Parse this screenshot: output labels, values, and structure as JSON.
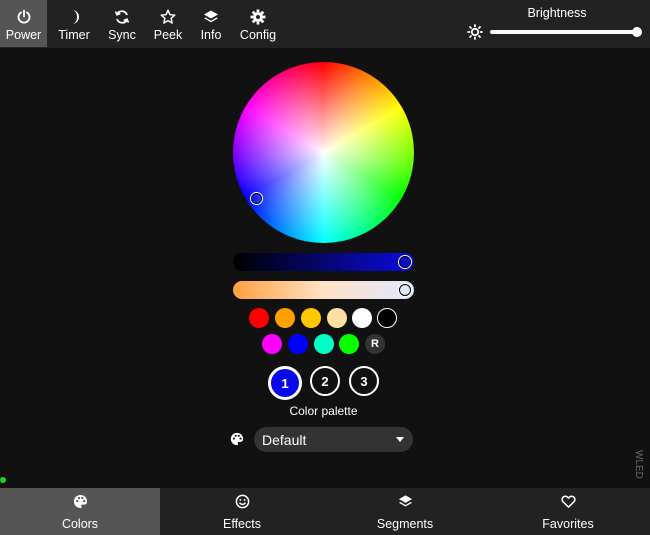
{
  "topbar": {
    "buttons": [
      {
        "label": "Power",
        "icon": "power-icon",
        "active": true
      },
      {
        "label": "Timer",
        "icon": "moon-icon"
      },
      {
        "label": "Sync",
        "icon": "sync-icon"
      },
      {
        "label": "Peek",
        "icon": "star-icon"
      },
      {
        "label": "Info",
        "icon": "layers-icon"
      },
      {
        "label": "Config",
        "icon": "gear-icon"
      }
    ],
    "brightness_label": "Brightness",
    "brightness_level": 1.0
  },
  "colors": {
    "quick_swatches_row1": [
      "#ff0000",
      "#ffa000",
      "#ffc800",
      "#ffe0a0",
      "#ffffff",
      "#000000"
    ],
    "quick_swatches_row2": [
      "#ff00ff",
      "#0000ff",
      "#00ffc8",
      "#08ff00"
    ],
    "random_label": "R",
    "slots": [
      "1",
      "2",
      "3"
    ],
    "selected_slot": "1",
    "selected_color": "#0a0ae8",
    "palette_label": "Color palette",
    "palette_value": "Default"
  },
  "footer_tag": "WLED",
  "bottombar": {
    "tabs": [
      {
        "label": "Colors",
        "icon": "palette-icon",
        "active": true
      },
      {
        "label": "Effects",
        "icon": "smiley-icon"
      },
      {
        "label": "Segments",
        "icon": "layers-icon"
      },
      {
        "label": "Favorites",
        "icon": "heart-icon"
      }
    ]
  }
}
